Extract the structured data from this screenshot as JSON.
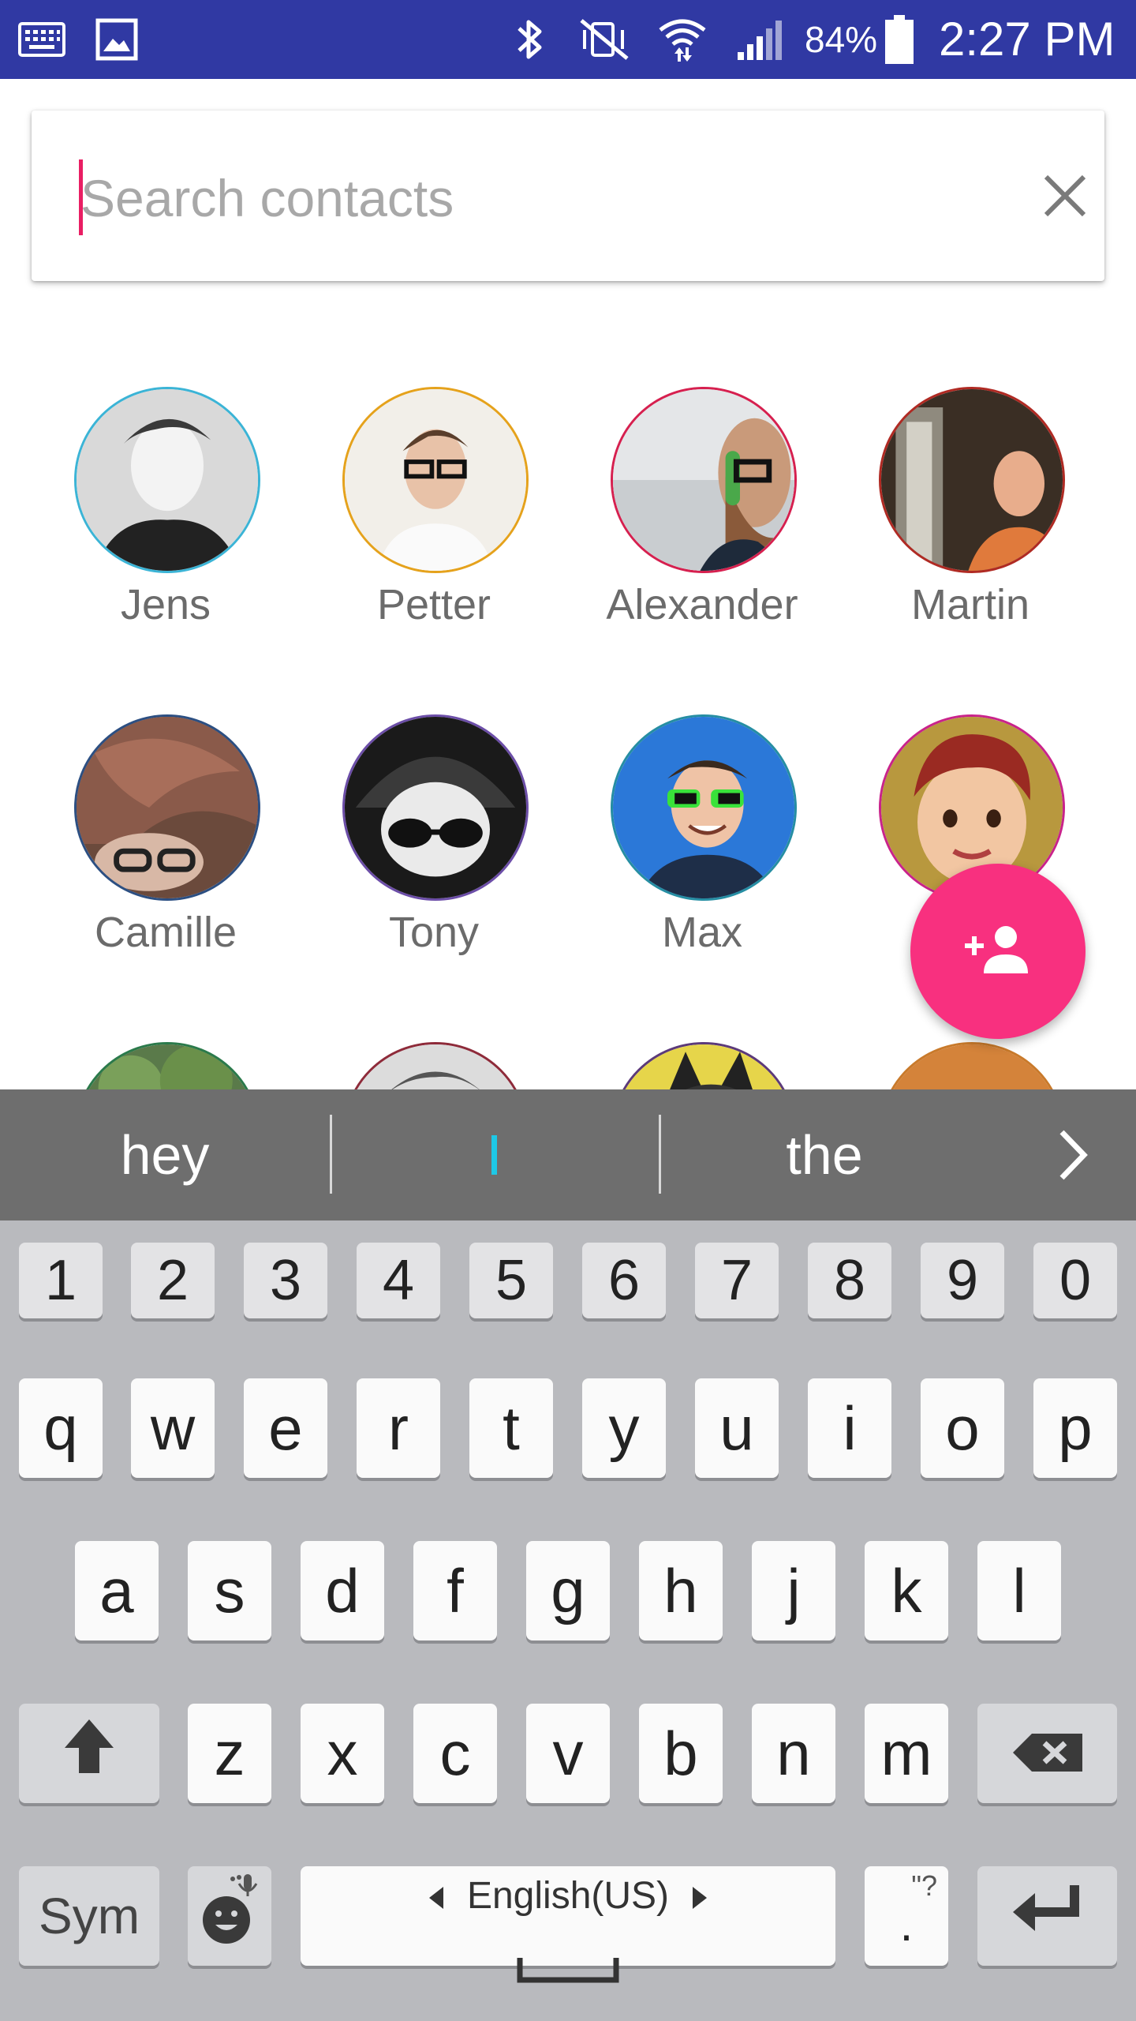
{
  "status_bar": {
    "left_icons": [
      "keyboard-icon",
      "image-icon"
    ],
    "right_icons": [
      "bluetooth-icon",
      "vibrate-off-icon",
      "wifi-icon",
      "signal-icon",
      "battery-icon"
    ],
    "battery": "84%",
    "time": "2:27 PM",
    "background": "#3039a3"
  },
  "search": {
    "placeholder": "Search contacts",
    "value": "",
    "caret_color": "#e91e63",
    "clear_icon": "close-icon"
  },
  "contacts": [
    {
      "name": "Jens",
      "ring": "#3bb4d6"
    },
    {
      "name": "Petter",
      "ring": "#e5a21c"
    },
    {
      "name": "Alexander",
      "ring": "#d6204f"
    },
    {
      "name": "Martin",
      "ring": "#b02a23"
    },
    {
      "name": "Camille",
      "ring": "#2c4f82"
    },
    {
      "name": "Tony",
      "ring": "#6c4ea8"
    },
    {
      "name": "Max",
      "ring": "#268ea3"
    },
    {
      "name": "",
      "ring": "#c9238b"
    },
    {
      "name": "",
      "ring": "#2b7a4b"
    },
    {
      "name": "",
      "ring": "#8e2b3a"
    },
    {
      "name": "",
      "ring": "#5c3a7a"
    },
    {
      "name": "",
      "ring": "#c97a2b"
    }
  ],
  "fab": {
    "icon": "add-person-icon",
    "color": "#f8307f"
  },
  "suggestions": {
    "left": "hey",
    "middle": "I",
    "right": "the",
    "more_icon": "chevron-right-icon"
  },
  "keyboard": {
    "number_row": [
      "1",
      "2",
      "3",
      "4",
      "5",
      "6",
      "7",
      "8",
      "9",
      "0"
    ],
    "row1": [
      "q",
      "w",
      "e",
      "r",
      "t",
      "y",
      "u",
      "i",
      "o",
      "p"
    ],
    "row2": [
      "a",
      "s",
      "d",
      "f",
      "g",
      "h",
      "j",
      "k",
      "l"
    ],
    "row3": [
      "z",
      "x",
      "c",
      "v",
      "b",
      "n",
      "m"
    ],
    "sym_label": "Sym",
    "space_label": "English(US)",
    "period_label": ".",
    "period_hint": "\"?",
    "shift_icon": "shift-arrow-icon",
    "backspace_icon": "backspace-icon",
    "emoji_icon": "emoji-mic-icon",
    "enter_icon": "enter-icon"
  }
}
